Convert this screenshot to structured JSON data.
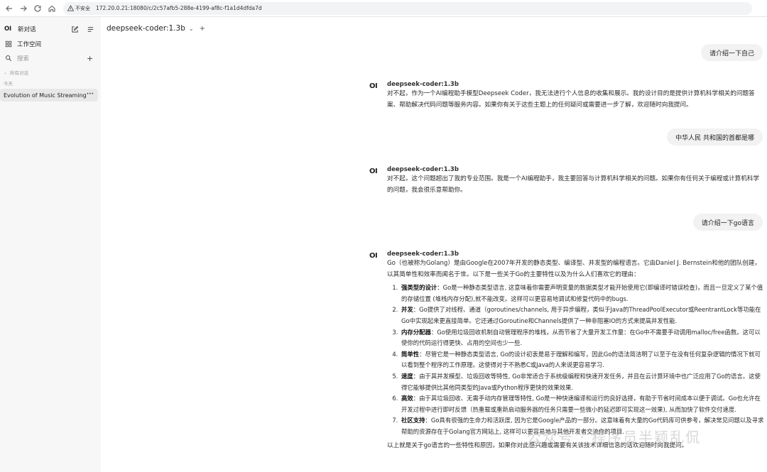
{
  "browser": {
    "insecure_label": "不安全",
    "url": "172.20.0.21:18080/c/2c57afb5-288e-4199-af8c-f1a1d4dfda7d"
  },
  "sidebar": {
    "logo": "OI",
    "new_chat": "新对话",
    "workspace": "工作空间",
    "search_placeholder": "搜索",
    "all_chats": "所有对话",
    "today": "今天",
    "chats": [
      {
        "title": "Evolution of Music Streaming"
      }
    ]
  },
  "header": {
    "model": "deepseek-coder:1.3b"
  },
  "messages": [
    {
      "role": "user",
      "text": "请介绍一下自己"
    },
    {
      "role": "assistant",
      "avatar": "OI",
      "name": "deepseek-coder:1.3b",
      "text": "对不起，作为一个AI编程助手模型Deepseek Coder，我无法进行个人信息的收集和展示。我的设计目的是提供计算机科学相关的问题答案、帮助解决代码问题等服务内容。如果你有关于这些主题上的任何疑问或需要进一步了解，欢迎随时向我提问。"
    },
    {
      "role": "user",
      "text": "中华人民 共和国的首都是哪"
    },
    {
      "role": "assistant",
      "avatar": "OI",
      "name": "deepseek-coder:1.3b",
      "text": "对不起，这个问题超出了我的专业范围。我是一个AI编程助手，我主要回答与计算机科学相关的问题。如果你有任何关于编程或计算机科学的问题，我会很乐意帮助你。"
    },
    {
      "role": "user",
      "text": "请介绍一下go语言"
    },
    {
      "role": "assistant",
      "avatar": "OI",
      "name": "deepseek-coder:1.3b",
      "intro": "Go（也被称为Golang）是由Google在2007年开发的静态类型、编译型、并发型的编程语言。它由Daniel J. Bernstein和他的团队创建，以其简单性和效率而闻名于世。以下是一些关于Go的主要特性以及为什么人们喜欢它的理由：",
      "items": [
        {
          "title": "强类型的设计",
          "text": "：Go是一种静态类型语言, 这意味着你需要声明变量的数据类型才能开始使用它(即编译时错误检查)，而且一旦定义了某个值的存储位置 (堆栈内存分配),就不能改变。这样可以更容易地调试和修复代码中的bugs."
        },
        {
          "title": "并发",
          "text": "：Go提供了对线程、通道（goroutines/channels, 用于异步编程，类似于Java的ThreadPoolExecutor或ReentrantLock等功能在Go中实现起来更直接简单。它还通过Goroutine和Channels提供了一种非阻塞IO的方式来提高并发性能."
        },
        {
          "title": "内存分配器",
          "text": "：Go使用垃圾回收机制自动管理程序的堆栈，从而节省了大量开发工作量：在Go中不需要手动调用malloc/free函数。这可以使你的代码运行得更快、占用的空间也少一些."
        },
        {
          "title": "简单性",
          "text": "：尽管它是一种静态类型语言, Go的设计初衷是易于理解和编写，因此Go的语法简洁明了以至于在没有任何复杂逻辑的情况下就可以看到整个程序的工作原理。这使得对于不熟悉C或Java的人来说更容易学习."
        },
        {
          "title": "速度",
          "text": "：由于其并发模型、垃圾回收等特性, Go非常适合于系统级编程和快速开发任务，并且在云计算环境中也广泛应用了Go的语言。这使得它能够提供比其他同类型的Java或Python程序更快的效果效果."
        },
        {
          "title": "高效",
          "text": "：由于其垃圾回收、无需手动内存管理等特性, Go是一种快速编译和运行的良好选择，有助于节省时间成本以便于调试。Go也允许在开发过程中进行即时反馈（热重载或重新启动服务器的任务只需要一些微小的延迟即可实现这一效果), 从而加快了软件交付速度."
        },
        {
          "title": "社区支持",
          "text": "：Go具有很强的生命力和活跃度, 因为它是Google产品的一部分。这意味着有大量的Go代码库可供参考，解决常见问题以及寻求帮助的资源存在于Golang官方网站上, 这样可以更容易地与其他开发者交流你的项目."
        }
      ],
      "outro": "以上就是关于go语言的一些特性和原因，如果你对此感兴趣或需要有关该技术详细信息的话欢迎随时向我提问。"
    }
  ],
  "watermark": "公众号 · 程序员半颖乱侃"
}
